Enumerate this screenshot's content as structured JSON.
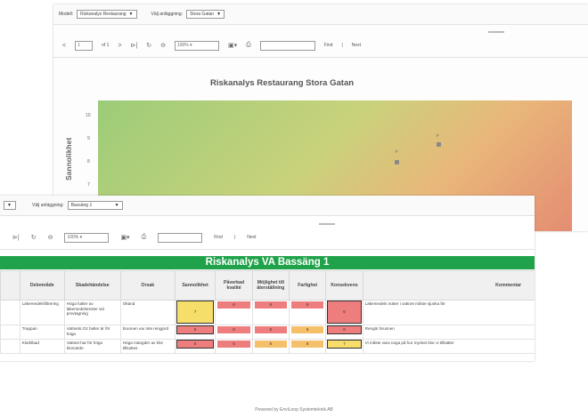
{
  "back": {
    "filters": {
      "project_label": "Modell:",
      "project_value": "Riskanalys Restaurang",
      "facility_label": "Välj anläggning:",
      "facility_value": "Stora Gatan"
    },
    "toolbar": {
      "page": "1",
      "of": "of 1",
      "zoom": "100%",
      "find": "Find",
      "next": "Next"
    },
    "chart_data": {
      "type": "scatter",
      "title": "Riskanalys Restaurang  Stora Gatan",
      "ylabel": "Sannolikhet",
      "y_ticks": [
        "10",
        "9",
        "8",
        "7"
      ],
      "points": [
        {
          "label": "F",
          "y": 7.8
        },
        {
          "label": "F",
          "y": 8.7
        }
      ]
    }
  },
  "front": {
    "filters": {
      "facility_label": "Välj anläggning:",
      "facility_value": "Bassäng 1"
    },
    "toolbar": {
      "zoom": "100%",
      "find": "Find",
      "next": "Next"
    },
    "title": "Riskanalys VA Bassäng 1",
    "columns": [
      "Delområde",
      "Skadehändelse",
      "Orsak",
      "Sannolikhet",
      "Påverkad kvalité",
      "Möjlighet till återställning",
      "Farlighet",
      "Konsekvens",
      "Kommentar"
    ],
    "rows": [
      {
        "area": "Läkemedelsfiltrering",
        "event": "Höga halter av läkemedelsrester vid provtagning",
        "cause": "Okänd",
        "risk": [
          "7",
          "6",
          "6",
          "6",
          "6"
        ],
        "comment": "Läkemedels mäter i vattnet måste sjunka för"
      },
      {
        "area": "Trappan",
        "event": "Vattnets O2 halter är för höga",
        "cause": "brunnen var inte rengjord",
        "risk": [
          "6",
          "6",
          "6",
          "6",
          "6"
        ],
        "comment": "Rengör brunnen"
      },
      {
        "area": "Klorklbad",
        "event": "Vattnet har för höga klorvärde",
        "cause": "Höga mängder av klor tillsattes",
        "risk": [
          "5",
          "5",
          "6",
          "6",
          "7"
        ],
        "comment": "Vi måste vara noga på hur mycket klor vi tillsätter"
      }
    ],
    "footer": "Powered by EnviLoop Systemteknik AB"
  }
}
